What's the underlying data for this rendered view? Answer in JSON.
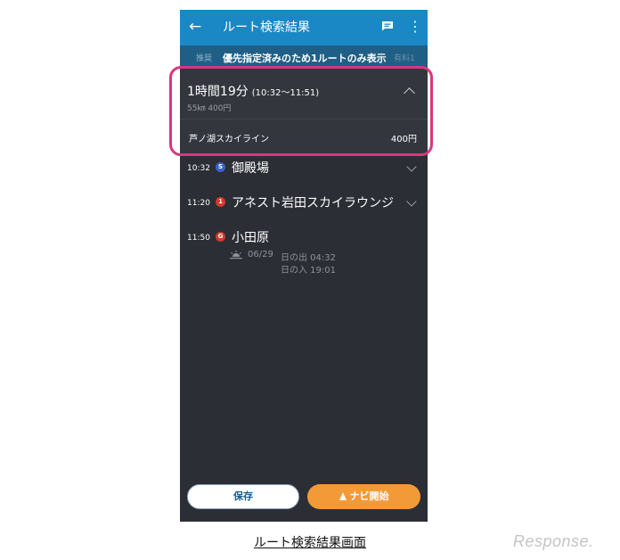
{
  "appbar": {
    "title": "ルート検索結果",
    "back_glyph": "←",
    "more_glyph": "⋮"
  },
  "tabs": {
    "left_tab": "推奨",
    "notice": "優先指定済みのため1ルートのみ表示",
    "right_tab": "有料1"
  },
  "summary": {
    "duration": "1時間19分",
    "times": "(10:32〜11:51)",
    "meta": "55㎞  400円"
  },
  "toll": {
    "name": "芦ノ湖スカイライン",
    "price": "400円"
  },
  "stops": [
    {
      "time": "10:32",
      "badge": "S",
      "badge_color": "#3a62c8",
      "name": "御殿場"
    },
    {
      "time": "11:20",
      "badge": "1",
      "badge_color": "#d23a2a",
      "name": "アネスト岩田スカイラウンジ"
    },
    {
      "time": "11:50",
      "badge": "G",
      "badge_color": "#d23a2a",
      "name": "小田原"
    }
  ],
  "sun": {
    "date": "06/29",
    "sunrise": "日の出 04:32",
    "sunset": "日の入 19:01"
  },
  "buttons": {
    "save": "保存",
    "navi": "ナビ開始"
  },
  "caption": "ルート検索結果画面",
  "watermark": "Response.",
  "colors": {
    "appbar": "#1b88c6",
    "background": "#2b2e35",
    "highlight": "#d9367f",
    "navi_button": "#f39a38"
  }
}
